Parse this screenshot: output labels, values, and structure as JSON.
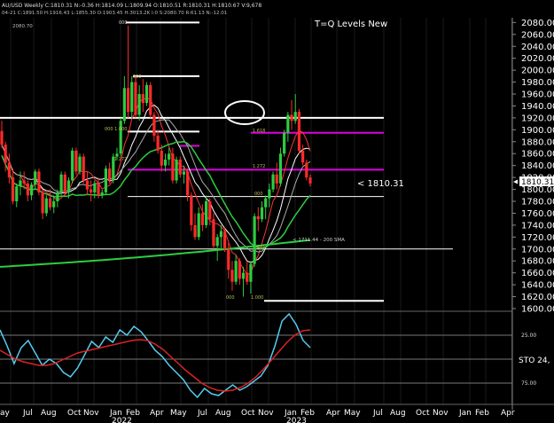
{
  "header": {
    "line1": "AU/USD  Weekly  C:1810.31  N:-0.36  H:1814.09  L:1809.94  O:1810.51  R:1810.31  H:1810.67  V:9,678",
    "line2": "04-21  C:1891.50  H:1916.43  L:1855.30  O:1903.45  H:3013.2K  I:0  S:2080.70  R:61.13  N:-12.01",
    "corner_value": "2080.70"
  },
  "chart_title": "T=Q Levels New",
  "price_label": "< 1810.31",
  "price_tag": "1810.31",
  "sma_note": "<  1711.44 - 200 SMA",
  "fib_labels": {
    "top": "000",
    "upper": "500",
    "mid": "000 1.000",
    "magenta_high": "1.618",
    "left_magenta": "1.272",
    "magenta_low": "1.272",
    "low_left": "000",
    "low_right": "1.000",
    "side_small_a": "000",
    "side_small_b": "000"
  },
  "stoch": {
    "label": "STO  24,",
    "level_high": "25.00",
    "level_low": "75.00"
  },
  "chart_data": {
    "type": "candlestick",
    "title": "T=Q Levels New",
    "price_axis": {
      "ylim": [
        1597,
        2088
      ],
      "ticks": [
        2080,
        2060,
        2040,
        2020,
        2000,
        1980,
        1960,
        1940,
        1920,
        1900,
        1880,
        1860,
        1840,
        1820,
        1800,
        1780,
        1760,
        1740,
        1720,
        1700,
        1680,
        1660,
        1640,
        1620,
        1600
      ]
    },
    "months": [
      {
        "label": "ay",
        "x": 4
      },
      {
        "label": "Jul",
        "x": 30
      },
      {
        "label": "Aug",
        "x": 50
      },
      {
        "label": "Oct",
        "x": 80
      },
      {
        "label": "Nov",
        "x": 98
      },
      {
        "label": "Jan",
        "x": 128
      },
      {
        "label": "Feb",
        "x": 146
      },
      {
        "label": "Apr",
        "x": 173
      },
      {
        "label": "May",
        "x": 196
      },
      {
        "label": "Jul",
        "x": 227
      },
      {
        "label": "Aug",
        "x": 247
      },
      {
        "label": "Oct",
        "x": 276
      },
      {
        "label": "Nov",
        "x": 295
      },
      {
        "label": "Jan",
        "x": 325
      },
      {
        "label": "Feb",
        "x": 343
      },
      {
        "label": "Apr",
        "x": 372
      },
      {
        "label": "May",
        "x": 392
      },
      {
        "label": "Jul",
        "x": 425
      },
      {
        "label": "Aug",
        "x": 444
      },
      {
        "label": "Oct",
        "x": 473
      },
      {
        "label": "Nov",
        "x": 492
      },
      {
        "label": "Jan",
        "x": 522
      },
      {
        "label": "Feb",
        "x": 540
      },
      {
        "label": "Apr",
        "x": 569
      }
    ],
    "years": [
      {
        "label": "2022",
        "x": 136
      },
      {
        "label": "2023",
        "x": 333
      }
    ],
    "last_price": 1810.31,
    "sma200_last": 1711.44,
    "levels": [
      {
        "price": 2080,
        "color": "#ffffff",
        "label": ""
      },
      {
        "price": 1990,
        "color": "#ffffff",
        "label": ""
      },
      {
        "price": 1920,
        "color": "#ffffff",
        "label": ""
      },
      {
        "price": 1897,
        "color": "#ffffff",
        "label": ""
      },
      {
        "price": 1895,
        "color": "#e000e0",
        "label": "1.618"
      },
      {
        "price": 1873,
        "color": "#e000e0",
        "label": ""
      },
      {
        "price": 1833,
        "color": "#e000e0",
        "label": "1.272"
      },
      {
        "price": 1788,
        "color": "#ffffff",
        "label": ""
      },
      {
        "price": 1700,
        "color": "#ffffff",
        "label": ""
      },
      {
        "price": 1613,
        "color": "#ffffff",
        "label": ""
      }
    ],
    "candles": [
      {
        "o": 1898,
        "h": 1915,
        "l": 1870,
        "c": 1875
      },
      {
        "o": 1875,
        "h": 1880,
        "l": 1830,
        "c": 1845
      },
      {
        "o": 1845,
        "h": 1860,
        "l": 1810,
        "c": 1820
      },
      {
        "o": 1820,
        "h": 1835,
        "l": 1775,
        "c": 1780
      },
      {
        "o": 1780,
        "h": 1810,
        "l": 1770,
        "c": 1805
      },
      {
        "o": 1805,
        "h": 1830,
        "l": 1790,
        "c": 1815
      },
      {
        "o": 1815,
        "h": 1830,
        "l": 1800,
        "c": 1810
      },
      {
        "o": 1810,
        "h": 1815,
        "l": 1780,
        "c": 1790
      },
      {
        "o": 1790,
        "h": 1812,
        "l": 1782,
        "c": 1808
      },
      {
        "o": 1808,
        "h": 1834,
        "l": 1800,
        "c": 1830
      },
      {
        "o": 1830,
        "h": 1835,
        "l": 1790,
        "c": 1795
      },
      {
        "o": 1795,
        "h": 1800,
        "l": 1750,
        "c": 1760
      },
      {
        "o": 1760,
        "h": 1790,
        "l": 1755,
        "c": 1785
      },
      {
        "o": 1785,
        "h": 1800,
        "l": 1765,
        "c": 1770
      },
      {
        "o": 1770,
        "h": 1790,
        "l": 1760,
        "c": 1780
      },
      {
        "o": 1780,
        "h": 1800,
        "l": 1770,
        "c": 1795
      },
      {
        "o": 1795,
        "h": 1830,
        "l": 1790,
        "c": 1825
      },
      {
        "o": 1825,
        "h": 1830,
        "l": 1790,
        "c": 1795
      },
      {
        "o": 1795,
        "h": 1820,
        "l": 1785,
        "c": 1815
      },
      {
        "o": 1815,
        "h": 1870,
        "l": 1810,
        "c": 1865
      },
      {
        "o": 1865,
        "h": 1870,
        "l": 1825,
        "c": 1830
      },
      {
        "o": 1830,
        "h": 1860,
        "l": 1825,
        "c": 1855
      },
      {
        "o": 1855,
        "h": 1860,
        "l": 1810,
        "c": 1815
      },
      {
        "o": 1815,
        "h": 1830,
        "l": 1790,
        "c": 1800
      },
      {
        "o": 1800,
        "h": 1815,
        "l": 1780,
        "c": 1795
      },
      {
        "o": 1795,
        "h": 1815,
        "l": 1785,
        "c": 1810
      },
      {
        "o": 1810,
        "h": 1820,
        "l": 1785,
        "c": 1790
      },
      {
        "o": 1790,
        "h": 1800,
        "l": 1785,
        "c": 1795
      },
      {
        "o": 1795,
        "h": 1840,
        "l": 1790,
        "c": 1835
      },
      {
        "o": 1835,
        "h": 1845,
        "l": 1810,
        "c": 1815
      },
      {
        "o": 1815,
        "h": 1860,
        "l": 1810,
        "c": 1855
      },
      {
        "o": 1855,
        "h": 1870,
        "l": 1850,
        "c": 1860
      },
      {
        "o": 1860,
        "h": 1920,
        "l": 1855,
        "c": 1915
      },
      {
        "o": 1915,
        "h": 1990,
        "l": 1910,
        "c": 1970
      },
      {
        "o": 1970,
        "h": 2075,
        "l": 1920,
        "c": 1930
      },
      {
        "o": 1930,
        "h": 1990,
        "l": 1920,
        "c": 1980
      },
      {
        "o": 1980,
        "h": 1990,
        "l": 1920,
        "c": 1925
      },
      {
        "o": 1925,
        "h": 1975,
        "l": 1915,
        "c": 1960
      },
      {
        "o": 1960,
        "h": 1985,
        "l": 1930,
        "c": 1945
      },
      {
        "o": 1945,
        "h": 1980,
        "l": 1940,
        "c": 1975
      },
      {
        "o": 1975,
        "h": 1980,
        "l": 1920,
        "c": 1925
      },
      {
        "o": 1925,
        "h": 1930,
        "l": 1880,
        "c": 1890
      },
      {
        "o": 1890,
        "h": 1900,
        "l": 1860,
        "c": 1865
      },
      {
        "o": 1865,
        "h": 1875,
        "l": 1830,
        "c": 1840
      },
      {
        "o": 1840,
        "h": 1860,
        "l": 1830,
        "c": 1850
      },
      {
        "o": 1850,
        "h": 1870,
        "l": 1840,
        "c": 1860
      },
      {
        "o": 1860,
        "h": 1870,
        "l": 1810,
        "c": 1815
      },
      {
        "o": 1815,
        "h": 1855,
        "l": 1810,
        "c": 1850
      },
      {
        "o": 1850,
        "h": 1855,
        "l": 1820,
        "c": 1825
      },
      {
        "o": 1825,
        "h": 1840,
        "l": 1810,
        "c": 1830
      },
      {
        "o": 1830,
        "h": 1835,
        "l": 1780,
        "c": 1790
      },
      {
        "o": 1790,
        "h": 1795,
        "l": 1730,
        "c": 1740
      },
      {
        "o": 1740,
        "h": 1760,
        "l": 1715,
        "c": 1720
      },
      {
        "o": 1720,
        "h": 1770,
        "l": 1715,
        "c": 1760
      },
      {
        "o": 1760,
        "h": 1775,
        "l": 1730,
        "c": 1740
      },
      {
        "o": 1740,
        "h": 1790,
        "l": 1735,
        "c": 1780
      },
      {
        "o": 1780,
        "h": 1785,
        "l": 1740,
        "c": 1750
      },
      {
        "o": 1750,
        "h": 1760,
        "l": 1700,
        "c": 1705
      },
      {
        "o": 1705,
        "h": 1725,
        "l": 1680,
        "c": 1720
      },
      {
        "o": 1720,
        "h": 1740,
        "l": 1700,
        "c": 1730
      },
      {
        "o": 1730,
        "h": 1735,
        "l": 1695,
        "c": 1700
      },
      {
        "o": 1700,
        "h": 1710,
        "l": 1650,
        "c": 1665
      },
      {
        "o": 1665,
        "h": 1680,
        "l": 1630,
        "c": 1645
      },
      {
        "o": 1645,
        "h": 1690,
        "l": 1640,
        "c": 1680
      },
      {
        "o": 1680,
        "h": 1685,
        "l": 1640,
        "c": 1650
      },
      {
        "o": 1650,
        "h": 1670,
        "l": 1620,
        "c": 1660
      },
      {
        "o": 1660,
        "h": 1680,
        "l": 1640,
        "c": 1645
      },
      {
        "o": 1645,
        "h": 1680,
        "l": 1625,
        "c": 1675
      },
      {
        "o": 1675,
        "h": 1760,
        "l": 1670,
        "c": 1755
      },
      {
        "o": 1755,
        "h": 1770,
        "l": 1730,
        "c": 1750
      },
      {
        "o": 1750,
        "h": 1780,
        "l": 1745,
        "c": 1770
      },
      {
        "o": 1770,
        "h": 1790,
        "l": 1750,
        "c": 1785
      },
      {
        "o": 1785,
        "h": 1810,
        "l": 1770,
        "c": 1800
      },
      {
        "o": 1800,
        "h": 1830,
        "l": 1795,
        "c": 1825
      },
      {
        "o": 1825,
        "h": 1845,
        "l": 1800,
        "c": 1810
      },
      {
        "o": 1810,
        "h": 1870,
        "l": 1805,
        "c": 1860
      },
      {
        "o": 1860,
        "h": 1900,
        "l": 1855,
        "c": 1895
      },
      {
        "o": 1895,
        "h": 1930,
        "l": 1880,
        "c": 1925
      },
      {
        "o": 1925,
        "h": 1950,
        "l": 1900,
        "c": 1915
      },
      {
        "o": 1915,
        "h": 1960,
        "l": 1910,
        "c": 1930
      },
      {
        "o": 1930,
        "h": 1935,
        "l": 1860,
        "c": 1865
      },
      {
        "o": 1865,
        "h": 1875,
        "l": 1840,
        "c": 1845
      },
      {
        "o": 1845,
        "h": 1850,
        "l": 1815,
        "c": 1820
      },
      {
        "o": 1820,
        "h": 1825,
        "l": 1805,
        "c": 1810
      }
    ]
  }
}
